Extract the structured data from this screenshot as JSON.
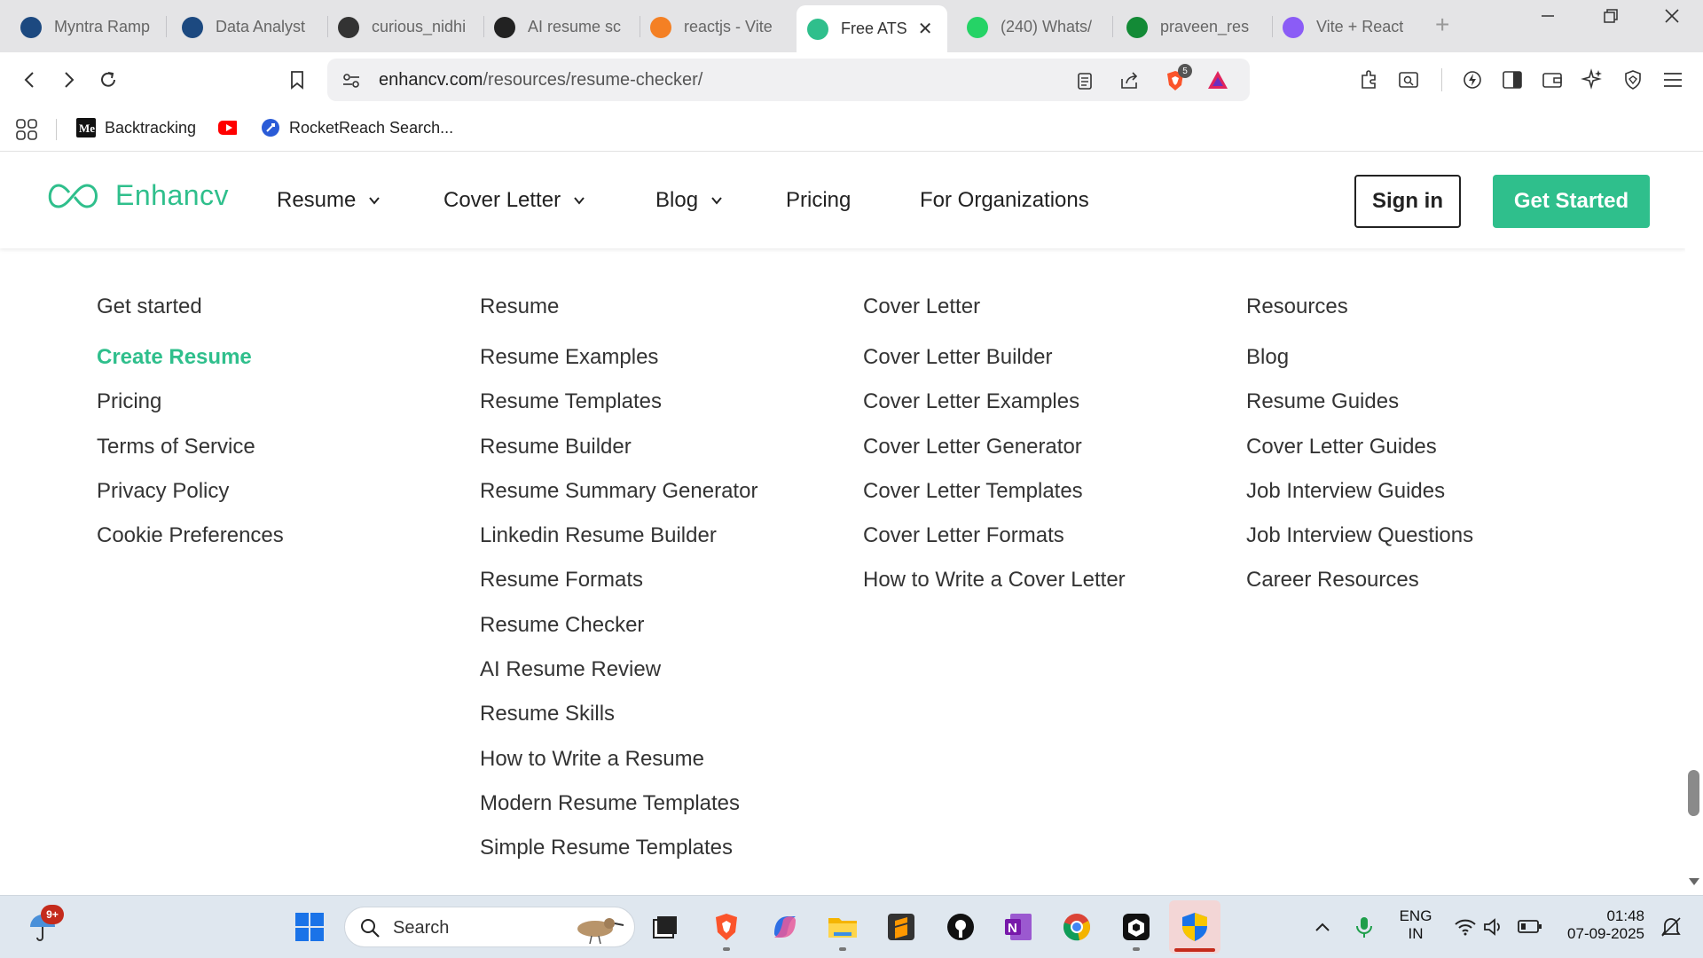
{
  "browser": {
    "tabs": [
      {
        "label": "Myntra Ramp",
        "icon": "unstop-icon",
        "color": "#1c4980"
      },
      {
        "label": "Data Analyst",
        "icon": "unstop-icon",
        "color": "#1c4980"
      },
      {
        "label": "curious_nidhi",
        "icon": "leetcode-icon",
        "color": "#333333"
      },
      {
        "label": "AI resume sc",
        "icon": "openai-icon",
        "color": "#222222"
      },
      {
        "label": "reactjs - Vite",
        "icon": "stackoverflow-icon",
        "color": "#f48024"
      },
      {
        "label": "Free ATS",
        "icon": "enhancv-icon",
        "color": "#2fbf8c"
      },
      {
        "label": "(240) Whats/",
        "icon": "whatsapp-icon",
        "color": "#25d366"
      },
      {
        "label": "praveen_res",
        "icon": "overleaf-icon",
        "color": "#138a36"
      },
      {
        "label": "Vite + React",
        "icon": "vite-icon",
        "color": "#8b5cf6"
      }
    ],
    "active_tab_index": 5,
    "address": {
      "domain": "enhancv.com",
      "path": "/resources/resume-checker/"
    },
    "brave_badge": "5",
    "bookmarks": [
      {
        "label": "Backtracking",
        "icon": "medium-icon"
      },
      {
        "label": "",
        "icon": "youtube-icon"
      },
      {
        "label": "RocketReach Search...",
        "icon": "rocketreach-icon"
      }
    ]
  },
  "site": {
    "logo_text": "Enhancv",
    "brand_color": "#2fbf8c",
    "nav": [
      {
        "label": "Resume",
        "has_dropdown": true
      },
      {
        "label": "Cover Letter",
        "has_dropdown": true
      },
      {
        "label": "Blog",
        "has_dropdown": true
      },
      {
        "label": "Pricing",
        "has_dropdown": false
      },
      {
        "label": "For Organizations",
        "has_dropdown": false
      }
    ],
    "sign_in": "Sign in",
    "get_started": "Get Started"
  },
  "footer": {
    "columns": [
      {
        "heading": "Get started",
        "links": [
          "Create Resume",
          "Pricing",
          "Terms of Service",
          "Privacy Policy",
          "Cookie Preferences"
        ],
        "highlight_index": 0
      },
      {
        "heading": "Resume",
        "links": [
          "Resume Examples",
          "Resume Templates",
          "Resume Builder",
          "Resume Summary Generator",
          "Linkedin Resume Builder",
          "Resume Formats",
          "Resume Checker",
          "AI Resume Review",
          "Resume Skills",
          "How to Write a Resume",
          "Modern Resume Templates",
          "Simple Resume Templates"
        ]
      },
      {
        "heading": "Cover Letter",
        "links": [
          "Cover Letter Builder",
          "Cover Letter Examples",
          "Cover Letter Generator",
          "Cover Letter Templates",
          "Cover Letter Formats",
          "How to Write a Cover Letter"
        ]
      },
      {
        "heading": "Resources",
        "links": [
          "Blog",
          "Resume Guides",
          "Cover Letter Guides",
          "Job Interview Guides",
          "Job Interview Questions",
          "Career Resources"
        ]
      }
    ]
  },
  "taskbar": {
    "notification_badge": "9+",
    "search_placeholder": "Search",
    "language_line1": "ENG",
    "language_line2": "IN",
    "time": "01:48",
    "date": "07-09-2025"
  }
}
